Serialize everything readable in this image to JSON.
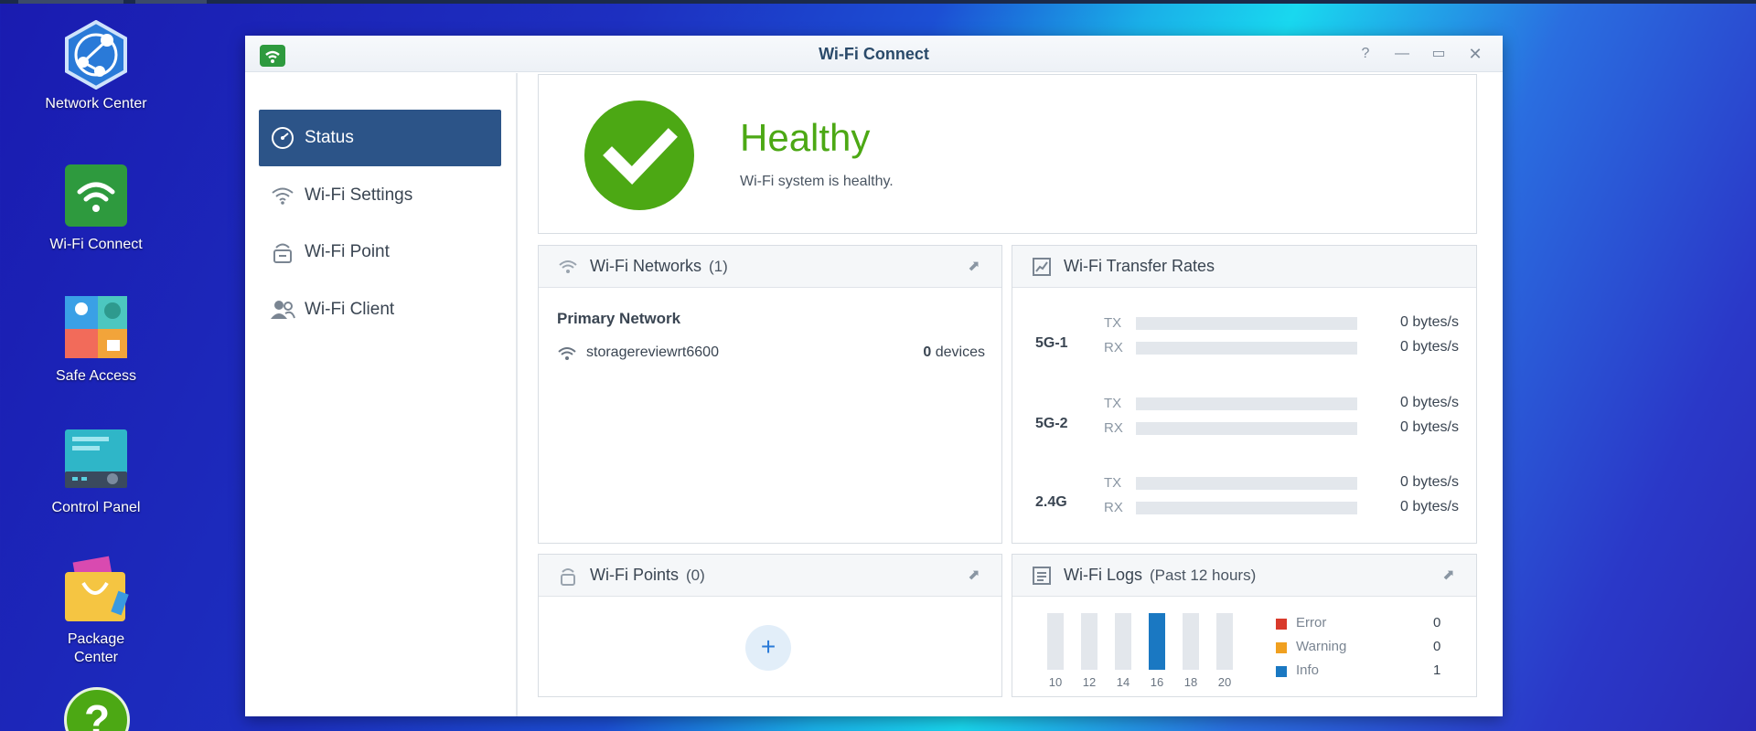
{
  "desktop": {
    "icons": [
      {
        "label": "Network Center"
      },
      {
        "label": "Wi-Fi Connect"
      },
      {
        "label": "Safe Access"
      },
      {
        "label": "Control Panel"
      },
      {
        "label": "Package Center"
      }
    ]
  },
  "window": {
    "title": "Wi-Fi Connect",
    "buttons": {
      "help": "?",
      "minimize": "—",
      "maximize": "▭",
      "close": "✕"
    }
  },
  "sidebar": {
    "items": [
      {
        "label": "Status",
        "icon": "gauge-icon",
        "active": true
      },
      {
        "label": "Wi-Fi Settings",
        "icon": "wifi-icon"
      },
      {
        "label": "Wi-Fi Point",
        "icon": "router-icon"
      },
      {
        "label": "Wi-Fi Client",
        "icon": "users-icon"
      }
    ]
  },
  "health": {
    "status": "Healthy",
    "description": "Wi-Fi system is healthy.",
    "color": "#4ca814"
  },
  "networks": {
    "title": "Wi-Fi Networks",
    "count": "(1)",
    "group_title": "Primary Network",
    "ssid": "storagereviewrt6600",
    "device_count": "0",
    "devices_label": "devices"
  },
  "transfer": {
    "title": "Wi-Fi Transfer Rates",
    "bands": [
      {
        "name": "5G-1",
        "tx_label": "TX",
        "rx_label": "RX",
        "tx": "0 bytes/s",
        "rx": "0 bytes/s"
      },
      {
        "name": "5G-2",
        "tx_label": "TX",
        "rx_label": "RX",
        "tx": "0 bytes/s",
        "rx": "0 bytes/s"
      },
      {
        "name": "2.4G",
        "tx_label": "TX",
        "rx_label": "RX",
        "tx": "0 bytes/s",
        "rx": "0 bytes/s"
      }
    ]
  },
  "points": {
    "title": "Wi-Fi Points",
    "count": "(0)",
    "add_label": "+"
  },
  "logs": {
    "title": "Wi-Fi Logs",
    "range": "(Past 12 hours)",
    "legend": [
      {
        "label": "Error",
        "value": "0",
        "color": "#d93a2b"
      },
      {
        "label": "Warning",
        "value": "0",
        "color": "#f0a020"
      },
      {
        "label": "Info",
        "value": "1",
        "color": "#1a78c2"
      }
    ]
  },
  "chart_data": {
    "type": "bar",
    "categories": [
      "10",
      "12",
      "14",
      "16",
      "18",
      "20"
    ],
    "values": [
      0,
      0,
      0,
      1,
      0,
      0
    ],
    "title": "",
    "xlabel": "",
    "ylabel": ""
  }
}
